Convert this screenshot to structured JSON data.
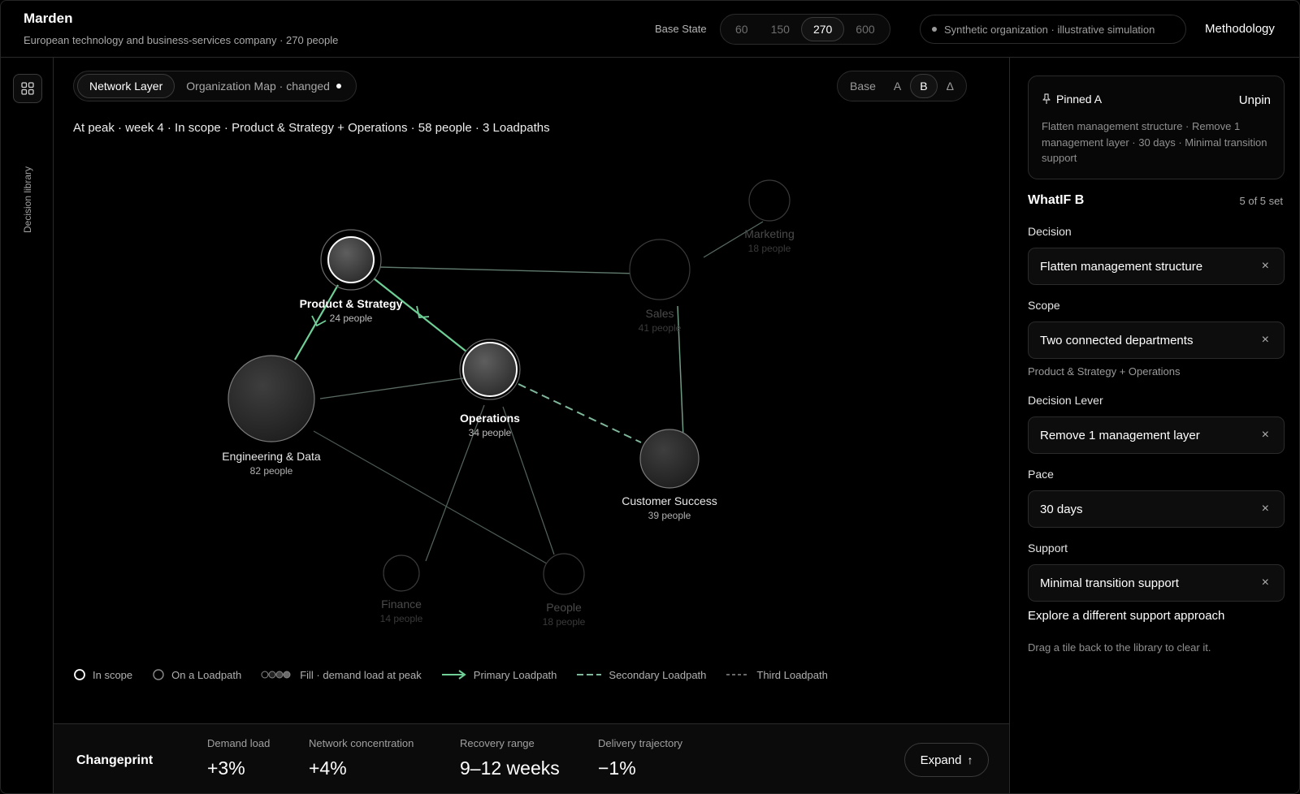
{
  "header": {
    "title": "Marden",
    "subtitle": "European technology and business-services company · 270 people",
    "base_state_label": "Base State",
    "base_states": [
      "60",
      "150",
      "270",
      "600"
    ],
    "base_state_selected": "270",
    "synthetic_note": "Synthetic organization · illustrative simulation",
    "methodology": "Methodology"
  },
  "rail": {
    "icon": "grid-icon",
    "label": "Decision library"
  },
  "main": {
    "layer_tabs": [
      {
        "label": "Network Layer",
        "active": true
      },
      {
        "label": "Organization Map · changed",
        "active": false
      }
    ],
    "compare_options": [
      "Base",
      "A",
      "B",
      "Δ"
    ],
    "compare_selected": "B",
    "status_line": "At peak · week 4 · In scope · Product & Strategy + Operations · 58 people · 3 Loadpaths"
  },
  "network": {
    "nodes": [
      {
        "id": "product",
        "name": "Product & Strategy",
        "people": "24 people",
        "state": "in-scope"
      },
      {
        "id": "engineering",
        "name": "Engineering & Data",
        "people": "82 people",
        "state": "loadpath"
      },
      {
        "id": "operations",
        "name": "Operations",
        "people": "34 people",
        "state": "in-scope"
      },
      {
        "id": "sales",
        "name": "Sales",
        "people": "41 people",
        "state": "dim"
      },
      {
        "id": "marketing",
        "name": "Marketing",
        "people": "18 people",
        "state": "dim"
      },
      {
        "id": "customer",
        "name": "Customer Success",
        "people": "39 people",
        "state": "loadpath"
      },
      {
        "id": "finance",
        "name": "Finance",
        "people": "14 people",
        "state": "dim"
      },
      {
        "id": "people",
        "name": "People",
        "people": "18 people",
        "state": "dim"
      }
    ],
    "colors": {
      "primary_loadpath": "#6fcf97",
      "secondary_loadpath": "#5f9f80",
      "link": "#5a6a62"
    }
  },
  "legend": [
    {
      "icon": "in-scope-ring-icon",
      "label": "In scope"
    },
    {
      "icon": "loadpath-ring-icon",
      "label": "On a Loadpath"
    },
    {
      "icon": "fill-scale-icon",
      "label": "Fill · demand load at peak"
    },
    {
      "icon": "primary-arrow-icon",
      "label": "Primary Loadpath"
    },
    {
      "icon": "secondary-dash-icon",
      "label": "Secondary Loadpath"
    },
    {
      "icon": "third-dot-icon",
      "label": "Third Loadpath"
    }
  ],
  "changeprint": {
    "title": "Changeprint",
    "metrics": [
      {
        "label": "Demand load",
        "value": "+3%"
      },
      {
        "label": "Network concentration",
        "value": "+4%"
      },
      {
        "label": "Recovery range",
        "value": "9–12 weeks"
      },
      {
        "label": "Delivery trajectory",
        "value": "−1%"
      }
    ],
    "expand": "Expand"
  },
  "panel": {
    "pinned": {
      "title": "Pinned A",
      "unpin": "Unpin",
      "description": "Flatten management structure · Remove 1 management layer · 30 days · Minimal transition support"
    },
    "whatif_title": "WhatIF B",
    "whatif_count": "5 of 5 set",
    "fields": [
      {
        "label": "Decision",
        "value": "Flatten management structure"
      },
      {
        "label": "Scope",
        "value": "Two connected departments",
        "note": "Product & Strategy + Operations"
      },
      {
        "label": "Decision Lever",
        "value": "Remove 1 management layer"
      },
      {
        "label": "Pace",
        "value": "30 days"
      },
      {
        "label": "Support",
        "value": "Minimal transition support"
      }
    ],
    "explore": "Explore a different support approach",
    "drag_note": "Drag a tile back to the library to clear it.",
    "clear_glyph": "×"
  }
}
